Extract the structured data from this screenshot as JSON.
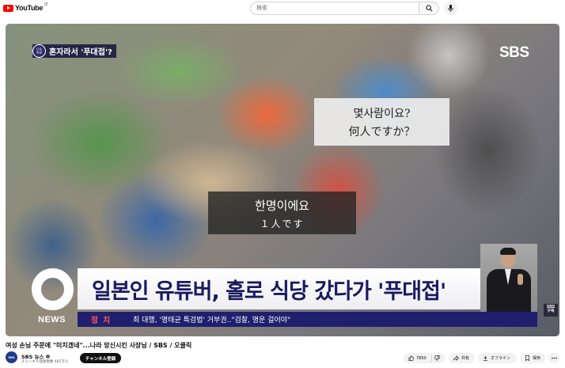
{
  "header": {
    "logo_text": "YouTube",
    "logo_region": "JP",
    "search_placeholder": "検索",
    "icons": {
      "search": "search-icon",
      "mic": "mic-icon",
      "logo": "youtube-logo-icon"
    }
  },
  "video": {
    "topic_badge_icon_text": "단독\n속보",
    "topic_badge": "혼자라서 '푸대접'?",
    "broadcaster_logo": "SBS",
    "subtitle_question_ko": "몇사람이요?",
    "subtitle_question_ja": "何人ですか？",
    "subtitle_answer_ko": "한명이에요",
    "subtitle_answer_ja": "１人です",
    "news_label": "NEWS",
    "headline": "일본인 유튜버, 홀로 식당 갔다가 '푸대접'",
    "ticker_category": "정치",
    "ticker_text": "최 대행, '명태균 특검법' 거부권..\"검찰, 명운 걸어야\"",
    "corner_logo": "SBS\n구독"
  },
  "info": {
    "title": "여성 손님 주문에 \"미치겠네\"...나라 망신시킨 사장님 / SBS / 오클릭",
    "channel_avatar_text": "SBS",
    "channel_name": "SBS 뉴스",
    "subscribers": "チャンネル登録者数 481万人",
    "subscribe_label": "チャンネル登録"
  },
  "actions": {
    "likes": "7850",
    "share": "共有",
    "offline": "オフライン",
    "save": "保存",
    "icons": [
      "like-icon",
      "dislike-icon",
      "share-icon",
      "download-icon",
      "save-icon",
      "more-icon"
    ]
  },
  "colors": {
    "brand_red": "#ff0000",
    "headline_navy": "#1a1a60",
    "ticker_bg": "#1f1f6e",
    "ticker_category": "#ff5a5a"
  }
}
